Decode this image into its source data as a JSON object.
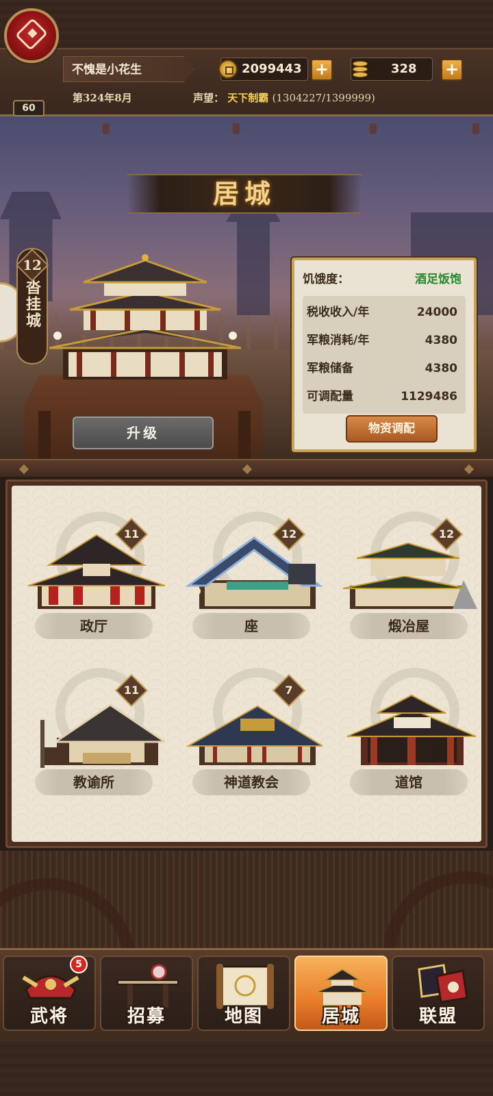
{
  "player": {
    "name": "不愧是小花生",
    "level": "60",
    "date": "第324年8月",
    "prestige_label": "声望：",
    "prestige_rank": "天下制霸",
    "prestige_value": "(1304227/1399999)"
  },
  "resources": {
    "coins": "2099443",
    "gold": "328",
    "plus": "+"
  },
  "scene": {
    "title": "居城",
    "side_level": "12",
    "side_name": "沓挂城",
    "upgrade_label": "升级"
  },
  "stats": {
    "hunger_label": "饥饿度：",
    "hunger_value": "酒足饭饱",
    "rows": [
      {
        "label": "税收收入/年",
        "value": "24000"
      },
      {
        "label": "军粮消耗/年",
        "value": "4380"
      },
      {
        "label": "军粮储备",
        "value": "4380"
      },
      {
        "label": "可调配量",
        "value": "1129486"
      }
    ],
    "dispatch_label": "物资调配"
  },
  "buildings": [
    {
      "name": "政厅",
      "level": "11"
    },
    {
      "name": "座",
      "level": "12"
    },
    {
      "name": "煅冶屋",
      "level": "12"
    },
    {
      "name": "教谕所",
      "level": "11"
    },
    {
      "name": "神道教会",
      "level": "7"
    },
    {
      "name": "道馆",
      "level": ""
    }
  ],
  "nav": [
    {
      "label": "武将",
      "badge": "5",
      "icon": "helmet-icon"
    },
    {
      "label": "招募",
      "badge": "",
      "icon": "sword-rack-icon"
    },
    {
      "label": "地图",
      "badge": "",
      "icon": "scroll-map-icon"
    },
    {
      "label": "居城",
      "badge": "",
      "icon": "castle-icon",
      "active": true
    },
    {
      "label": "联盟",
      "badge": "",
      "icon": "flag-icon"
    }
  ],
  "colors": {
    "accent_gold": "#c7a257",
    "active_tab": "#e87d2a",
    "hunger_green": "#1f8b2a",
    "title_gold": "#f2d38a"
  }
}
